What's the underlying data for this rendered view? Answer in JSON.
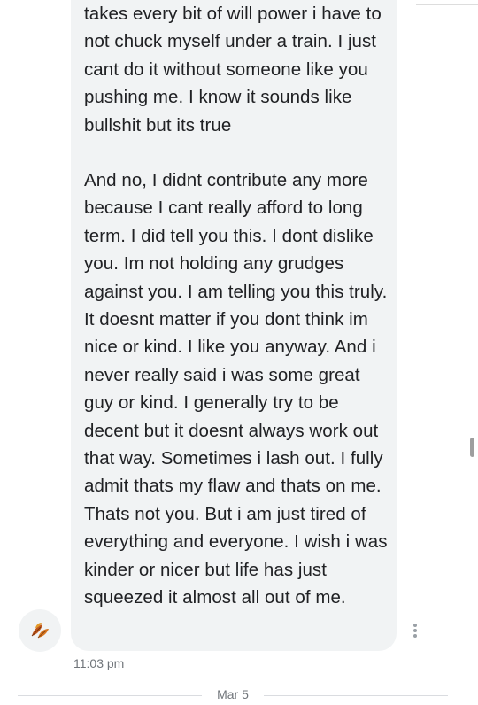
{
  "message": {
    "paragraph_1": "takes every bit of will power i have to not chuck myself under a train. I just cant do it without someone like you pushing me. I know it sounds like bullshit but its true",
    "paragraph_2": "And no, I didnt contribute any more because I cant really afford to long term. I did tell you this. I dont dislike you. Im not holding any grudges against you. I am telling you this truly. It doesnt matter if you dont think im nice or kind. I like you anyway. And i never really said i was some great guy or kind. I generally try to be decent but it doesnt always work out that way. Sometimes i lash out. I fully admit thats my flaw and thats on me. Thats not you. But i am just tired of everything and everyone. I wish i was kinder or nicer but life has just squeezed it almost all out of me.",
    "timestamp": "11:03 pm"
  },
  "avatar": {
    "icon": "autumn-leaves-icon"
  },
  "more_options": {
    "icon": "more-vert-icon"
  },
  "date_separator": {
    "label": "Mar 5"
  },
  "colors": {
    "bubble_bg": "#f1f3f4",
    "text": "#202124",
    "secondary_text": "#70757a"
  }
}
